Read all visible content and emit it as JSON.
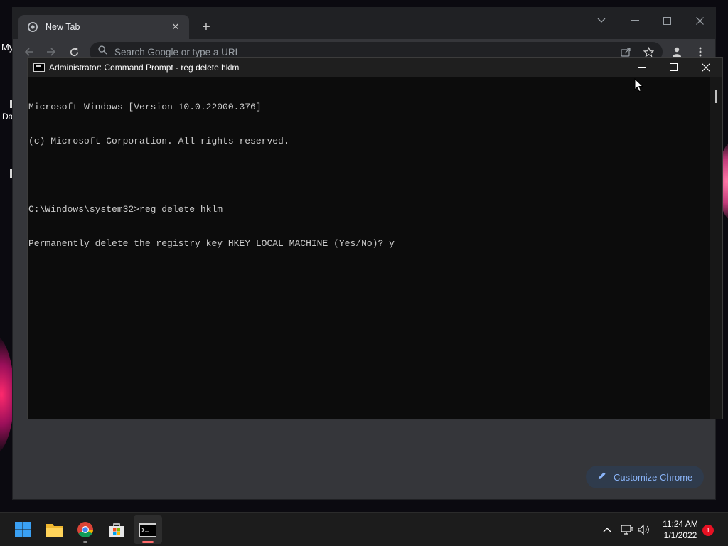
{
  "desktop": {
    "partial_label_1": "My",
    "partial_label_2": "Da"
  },
  "chrome": {
    "tab": {
      "title": "New Tab"
    },
    "toolbar": {
      "search_placeholder": "Search Google or type a URL"
    },
    "customize_label": "Customize Chrome",
    "accent_color": "#8ab4f8"
  },
  "cmd": {
    "title": "Administrator: Command Prompt - reg  delete hklm",
    "lines": [
      "Microsoft Windows [Version 10.0.22000.376]",
      "(c) Microsoft Corporation. All rights reserved.",
      "",
      "C:\\Windows\\system32>reg delete hklm",
      "Permanently delete the registry key HKEY_LOCAL_MACHINE (Yes/No)? y"
    ]
  },
  "taskbar": {
    "apps": [
      "start-icon",
      "file-explorer-icon",
      "chrome-icon",
      "store-icon",
      "terminal-icon"
    ],
    "time": "11:24 AM",
    "date": "1/1/2022",
    "notification_count": "1"
  }
}
